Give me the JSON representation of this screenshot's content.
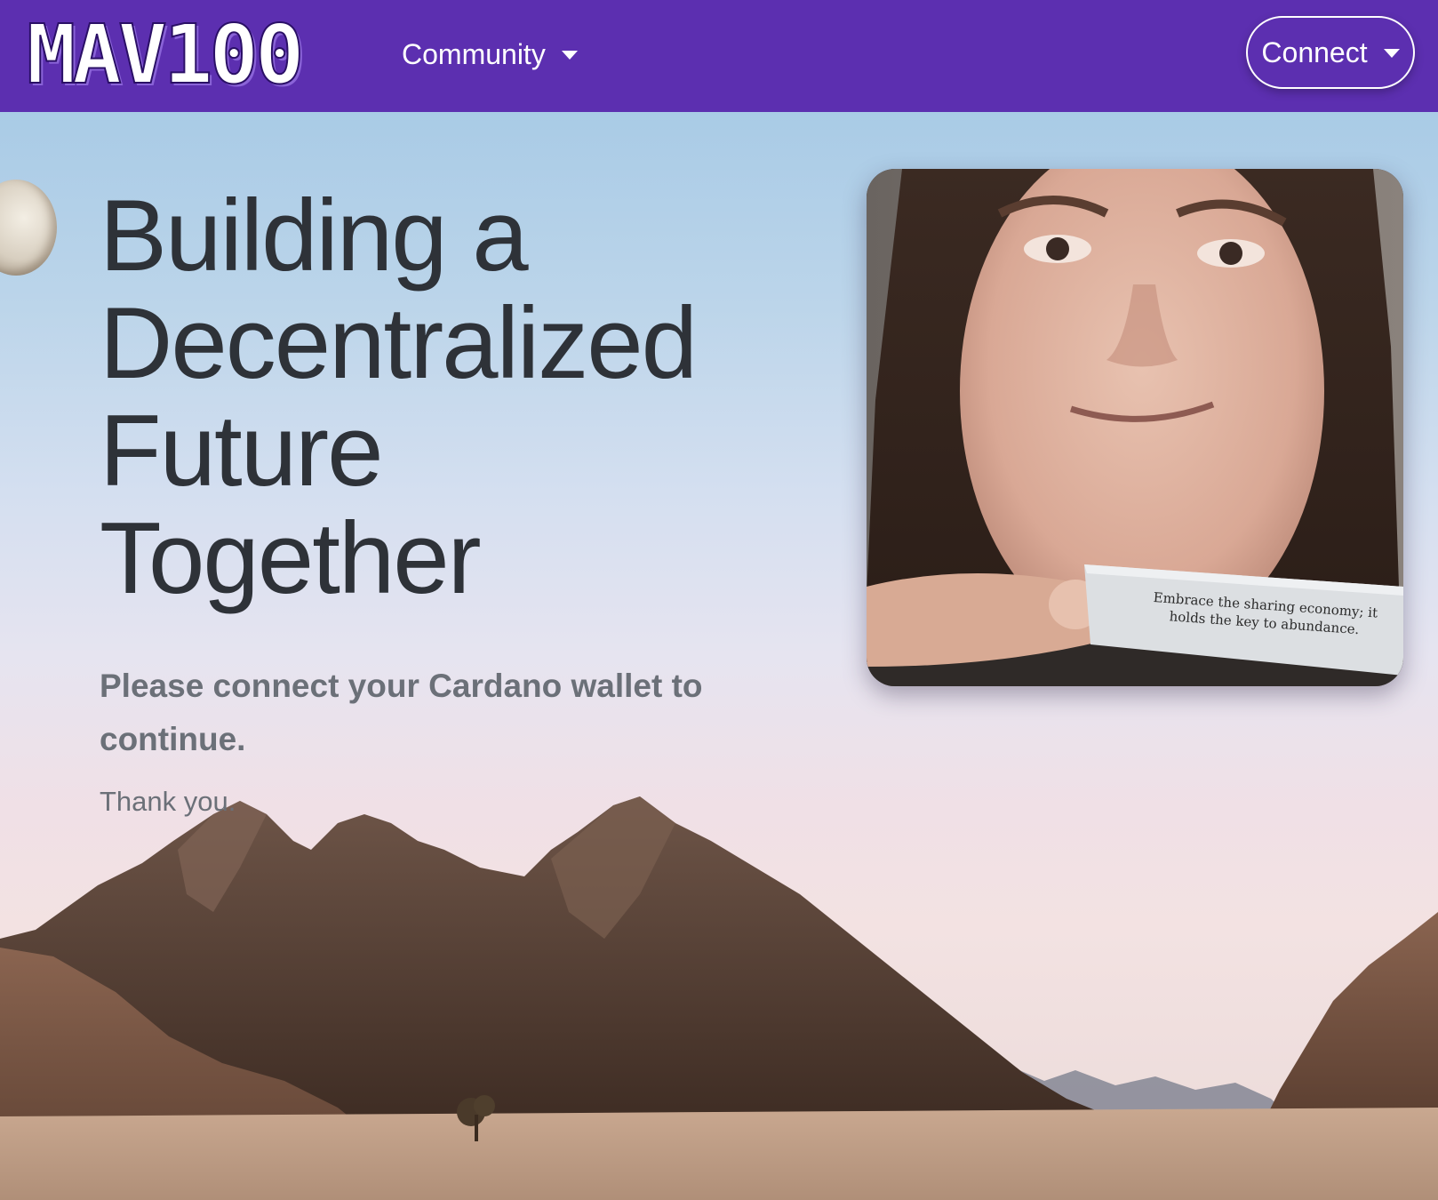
{
  "navbar": {
    "logo_text": "MAV100",
    "community_label": "Community",
    "connect_label": "Connect",
    "background_color": "#5c2fb0"
  },
  "hero": {
    "headline": "Building a Decentralized Future Together",
    "subtext": "Please connect your Cardano wallet to continue.",
    "thanks": "Thank you."
  },
  "photo": {
    "fortune_line1": "Embrace the sharing economy; it",
    "fortune_line2": "holds the key to abundance."
  },
  "icons": {
    "community_caret": "chevron-down-icon",
    "connect_caret": "chevron-down-icon"
  }
}
